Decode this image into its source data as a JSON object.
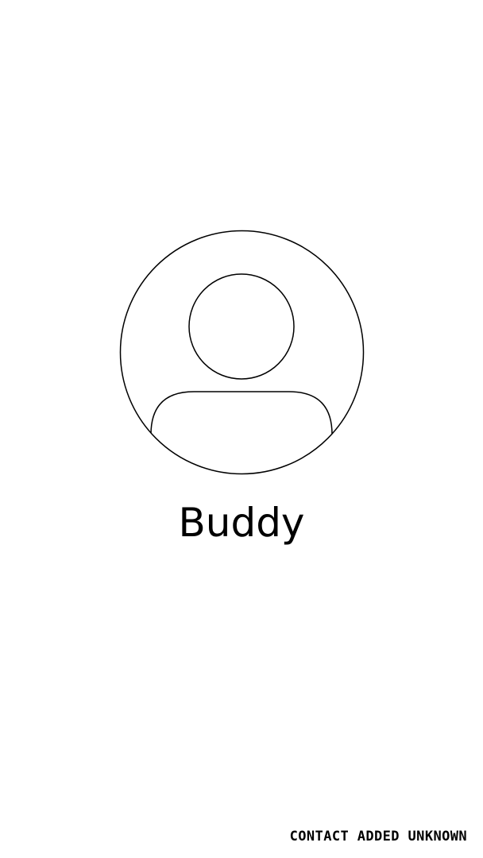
{
  "contact": {
    "avatar_icon": "person-placeholder-icon",
    "name": "Buddy"
  },
  "status": {
    "text": "CONTACT ADDED UNKNOWN"
  },
  "colors": {
    "background": "#ffffff",
    "foreground": "#000000"
  }
}
